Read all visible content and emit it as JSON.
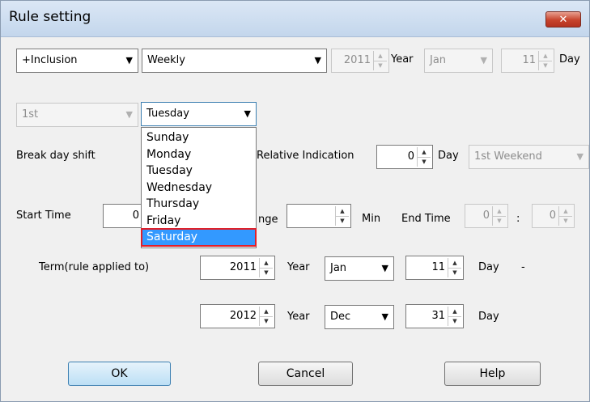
{
  "window": {
    "title": "Rule setting",
    "close_glyph": "✕"
  },
  "row1": {
    "inclusion": "+Inclusion",
    "frequency": "Weekly",
    "year_value": "2011",
    "year_label": "Year",
    "month_value": "Jan",
    "day_value": "11",
    "day_label": "Day"
  },
  "row2": {
    "ordinal": "1st",
    "weekday": "Tuesday"
  },
  "weekday_options": [
    "Sunday",
    "Monday",
    "Tuesday",
    "Wednesday",
    "Thursday",
    "Friday",
    "Saturday"
  ],
  "weekday_selected_index": 6,
  "row3": {
    "break_day_shift": "Break day shift",
    "relative_indication": "Relative Indication",
    "relative_value": "0",
    "day_label": "Day",
    "weekend_option": "1st Weekend"
  },
  "row4": {
    "start_time": "Start Time",
    "start_value": "0",
    "range_label": "nge",
    "range_value": "",
    "min_label": "Min",
    "end_time": "End Time",
    "end_hour": "0",
    "colon": ":",
    "end_min": "0"
  },
  "term": {
    "label": "Term(rule applied to)",
    "from_year": "2011",
    "year_label": "Year",
    "from_month": "Jan",
    "from_day": "11",
    "day_label": "Day",
    "dash": "-",
    "to_year": "2012",
    "to_month": "Dec",
    "to_day": "31"
  },
  "buttons": {
    "ok": "OK",
    "cancel": "Cancel",
    "help": "Help"
  }
}
